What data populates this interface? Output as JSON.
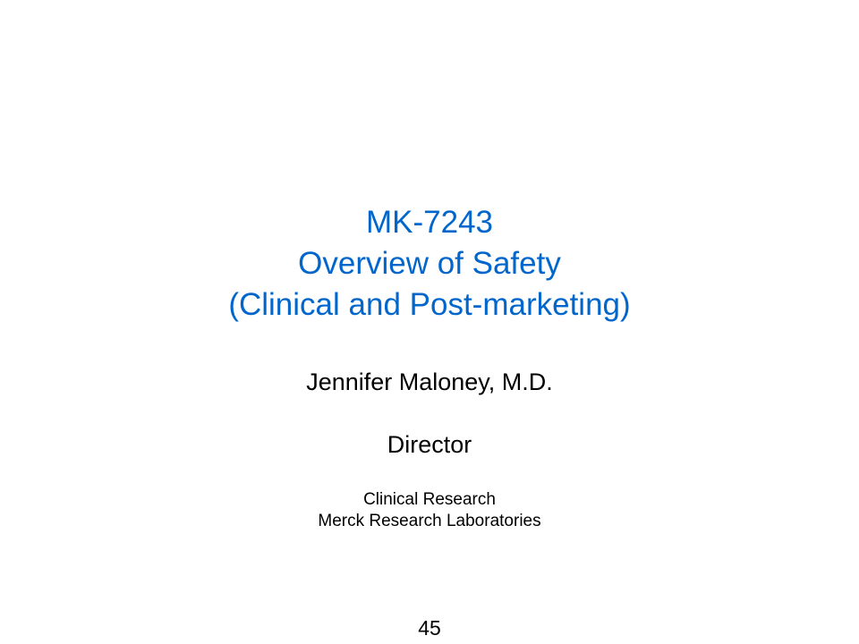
{
  "colors": {
    "accent": "#0066cc",
    "text": "#000000",
    "background": "#ffffff"
  },
  "title": {
    "line1": "MK-7243",
    "line2": "Overview of Safety",
    "line3": "(Clinical and Post-marketing)"
  },
  "presenter": {
    "name": "Jennifer Maloney, M.D.",
    "role": "Director",
    "department": "Clinical Research",
    "organization": "Merck Research Laboratories"
  },
  "page_number": "45"
}
